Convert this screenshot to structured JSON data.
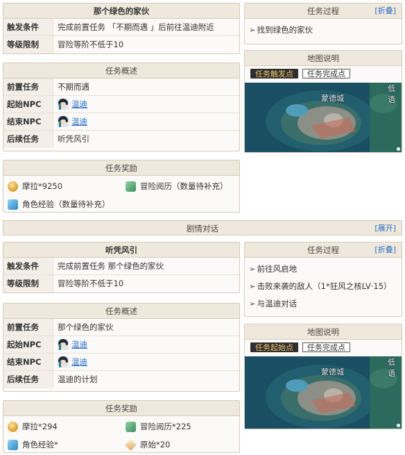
{
  "quest1": {
    "title": "那个绿色的家伙",
    "trigger_label": "触发条件",
    "trigger_value": "完成前置任务 「不期而遇 」后前往温迪附近",
    "level_label": "等级限制",
    "level_value": "冒险等阶不低于10",
    "overview_title": "任务概述",
    "prev_label": "前置任务",
    "prev_value": "不期而遇",
    "start_npc_label": "起始NPC",
    "start_npc_value": "温迪",
    "end_npc_label": "结束NPC",
    "end_npc_value": "温迪",
    "next_label": "后续任务",
    "next_value": "听凭风引",
    "rewards_title": "任务奖励",
    "rewards": [
      "摩拉*9250",
      "冒险阅历（数量待补充）",
      "角色经验（数量待补充）"
    ],
    "process_title": "任务过程",
    "process_toggle": "[折叠]",
    "process_items": [
      "找到绿色的家伙"
    ],
    "map_title": "地图说明",
    "map_tabs": [
      "任务触发点",
      "任务完成点"
    ],
    "map_labels": [
      "蒙德城",
      "低语"
    ]
  },
  "dialogue_bar": {
    "title": "剧情对话",
    "toggle": "[展开]"
  },
  "quest2": {
    "title": "听凭风引",
    "trigger_label": "触发条件",
    "trigger_value": "完成前置任务 那个绿色的家伙",
    "level_label": "等级限制",
    "level_value": "冒险等阶不低于10",
    "overview_title": "任务概述",
    "prev_label": "前置任务",
    "prev_value": "那个绿色的家伙",
    "start_npc_label": "起始NPC",
    "start_npc_value": "温迪",
    "end_npc_label": "结束NPC",
    "end_npc_value": "温迪",
    "next_label": "后续任务",
    "next_value": "温迪的计划",
    "rewards_title": "任务奖励",
    "rewards": [
      "摩拉*294",
      "冒险阅历*225",
      "角色经验*",
      "原始*20"
    ],
    "process_title": "任务过程",
    "process_toggle": "[折叠]",
    "process_items": [
      "前往风启地",
      "击败来袭的敌人（1*狂风之核LV·15）",
      "与温迪对话"
    ],
    "map_title": "地图说明",
    "map_tabs": [
      "任务起始点",
      "任务完成点"
    ],
    "map_labels": [
      "蒙德城",
      "低语"
    ]
  },
  "icons": {
    "arrow": "➢",
    "mora": "mora-coin-icon",
    "adventure": "adventure-exp-icon",
    "char_exp": "character-exp-icon",
    "primogem": "primogem-icon",
    "npc": "venti-avatar-icon"
  }
}
